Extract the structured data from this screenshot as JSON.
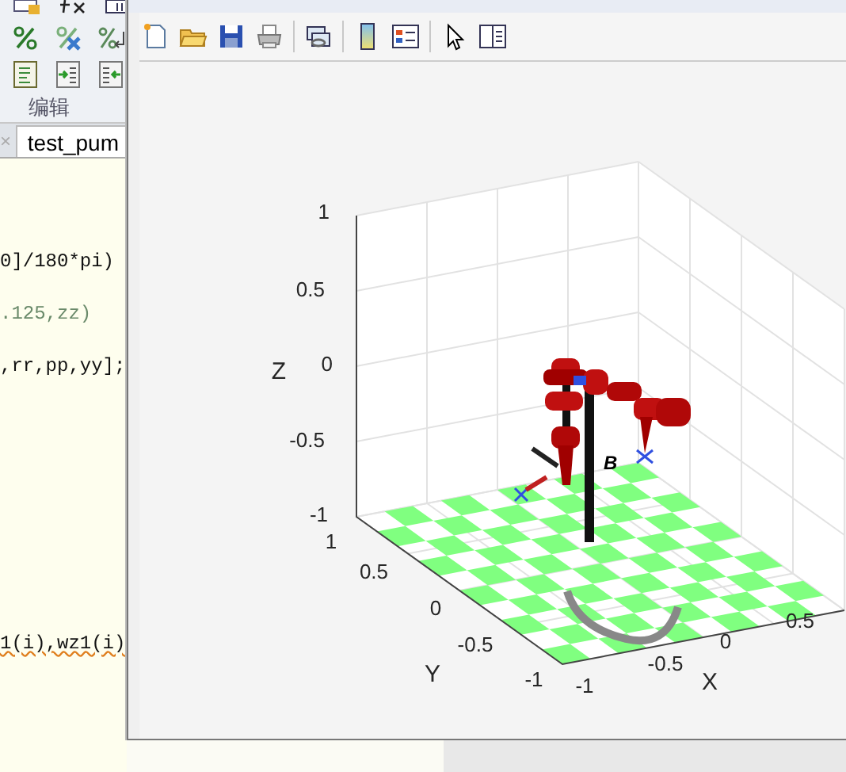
{
  "editor_toolstrip": {
    "section_label": "编辑"
  },
  "editor_tabs": [
    {
      "close": "×",
      "label": "test_pum",
      "selected": true
    }
  ],
  "code_lines": [
    {
      "text": "0]/180*pi)",
      "kind": "code"
    },
    {
      "text": ".125,zz)",
      "kind": "dim"
    },
    {
      "text": ",rr,pp,yy];",
      "kind": "code"
    },
    {
      "text": "1(i),wz1(i)",
      "kind": "warning"
    }
  ],
  "figure": {
    "toolbar": [
      {
        "kind": "new"
      },
      {
        "kind": "open"
      },
      {
        "kind": "save"
      },
      {
        "kind": "print"
      },
      {
        "kind": "link"
      },
      {
        "kind": "colorbar"
      },
      {
        "kind": "legend"
      },
      {
        "kind": "pointer"
      },
      {
        "kind": "panel"
      }
    ],
    "plot": {
      "z_label": "Z",
      "y_label": "Y",
      "x_label": "X",
      "robot_label": "B",
      "z_ticks": [
        "1",
        "0.5",
        "0",
        "-0.5",
        "-1"
      ],
      "y_ticks": [
        "1",
        "0.5",
        "0",
        "-0.5",
        "-1"
      ],
      "x_ticks": [
        "-1",
        "-0.5",
        "0",
        "0.5"
      ]
    }
  }
}
